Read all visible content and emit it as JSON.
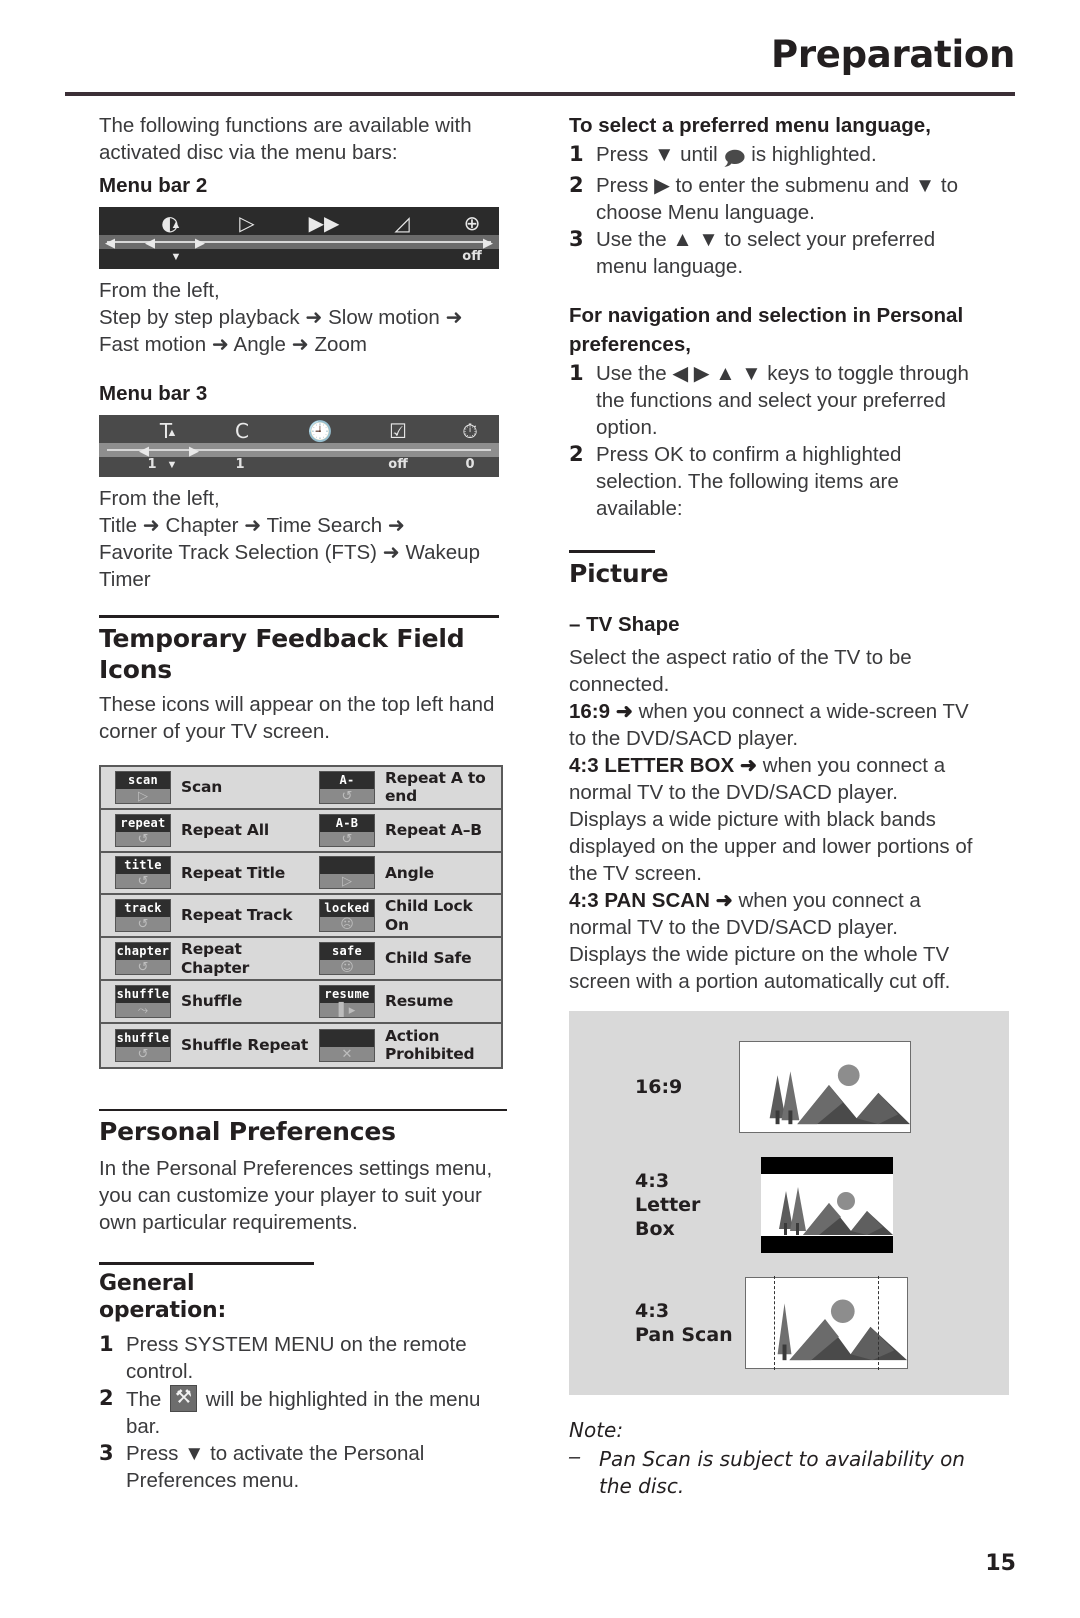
{
  "header": {
    "title": "Preparation"
  },
  "page": {
    "number": "15"
  },
  "left": {
    "intro": "The following functions are available with activated disc via the menu bars:",
    "menu_bar_2_heading": "Menu bar 2",
    "menu_bar_2": {
      "items": [
        {
          "icon": "step-by-step-icon",
          "glyph": "◐",
          "sub": ""
        },
        {
          "icon": "slow-motion-icon",
          "glyph": "▷",
          "sub": ""
        },
        {
          "icon": "fast-motion-icon",
          "glyph": "▶▶",
          "sub": ""
        },
        {
          "icon": "angle-icon",
          "glyph": "◿",
          "sub": ""
        },
        {
          "icon": "zoom-icon",
          "glyph": "⊕",
          "sub": "off"
        }
      ]
    },
    "menu_bar_2_caption_lead": "From the left,",
    "menu_bar_2_caption_line1": "Step by step playback ➜ Slow motion ➜",
    "menu_bar_2_caption_line2": "Fast motion ➜ Angle ➜ Zoom",
    "menu_bar_3_heading": "Menu bar 3",
    "menu_bar_3": {
      "items": [
        {
          "icon": "title-icon",
          "glyph": "T",
          "sub": "1"
        },
        {
          "icon": "chapter-icon",
          "glyph": "C",
          "sub": "1"
        },
        {
          "icon": "time-search-icon",
          "glyph": "🕘",
          "sub": ""
        },
        {
          "icon": "fts-icon",
          "glyph": "☑",
          "sub": "off"
        },
        {
          "icon": "wakeup-timer-icon",
          "glyph": "⏱",
          "sub": "0"
        }
      ]
    },
    "menu_bar_3_caption_lead": "From the left,",
    "menu_bar_3_caption_line1": "Title ➜ Chapter ➜ Time Search ➜",
    "menu_bar_3_caption_line2": "Favorite Track Selection (FTS) ➜ Wakeup Timer",
    "feedback_heading": "Temporary Feedback Field Icons",
    "feedback_intro": "These icons will appear on the top left hand corner of your TV screen.",
    "icon_table": [
      {
        "left": {
          "chip": "scan",
          "symbol": "▷",
          "label": "Scan"
        },
        "right": {
          "chip": "A-",
          "symbol": "↺",
          "label": "Repeat A to end"
        }
      },
      {
        "left": {
          "chip": "repeat",
          "symbol": "↺",
          "label": "Repeat All"
        },
        "right": {
          "chip": "A-B",
          "symbol": "↺",
          "label": "Repeat A–B"
        }
      },
      {
        "left": {
          "chip": "title",
          "symbol": "↺",
          "label": "Repeat Title"
        },
        "right": {
          "chip": "",
          "symbol": "▷",
          "label": "Angle"
        }
      },
      {
        "left": {
          "chip": "track",
          "symbol": "↺",
          "label": "Repeat Track"
        },
        "right": {
          "chip": "locked",
          "symbol": "☹",
          "label": "Child Lock On"
        }
      },
      {
        "left": {
          "chip": "chapter",
          "symbol": "↺",
          "label": "Repeat Chapter"
        },
        "right": {
          "chip": "safe",
          "symbol": "☺",
          "label": "Child Safe"
        }
      },
      {
        "left": {
          "chip": "shuffle",
          "symbol": "⤳",
          "label": "Shuffle"
        },
        "right": {
          "chip": "resume",
          "symbol": "▌▸",
          "label": "Resume"
        }
      },
      {
        "left": {
          "chip": "shuffle",
          "symbol": "↺",
          "label": "Shuffle Repeat"
        },
        "right": {
          "chip": "",
          "symbol": "✕",
          "label": "Action Prohibited"
        }
      }
    ],
    "personal_pref_heading": "Personal Preferences",
    "personal_pref_body": "In the Personal Preferences settings menu, you can customize your player to suit your own particular requirements.",
    "general_operation_heading": "General operation:",
    "general_operation_steps": [
      {
        "num": "1",
        "text": "Press SYSTEM MENU on the remote control."
      },
      {
        "num": "2",
        "text_before": "The ",
        "text_after": " will be highlighted in the menu bar."
      },
      {
        "num": "3",
        "text": "Press ▼ to activate the Personal Preferences menu."
      }
    ]
  },
  "right": {
    "menu_language_heading": "To select a preferred menu language,",
    "menu_language_steps": [
      {
        "num": "1",
        "text_before": "Press ▼ until ",
        "text_after": " is highlighted."
      },
      {
        "num": "2",
        "text": "Press ▶ to enter the submenu and ▼ to choose Menu language."
      },
      {
        "num": "3",
        "text": "Use the ▲ ▼ to select your preferred menu language."
      }
    ],
    "navigation_heading_line1": "For navigation and selection in Personal",
    "navigation_heading_line2": "preferences,",
    "navigation_steps": [
      {
        "num": "1",
        "text": "Use the ◀ ▶ ▲ ▼ keys to toggle through the functions and select your preferred option."
      },
      {
        "num": "2",
        "text": "Press OK to confirm a highlighted selection. The following items are available:"
      }
    ],
    "picture_heading": "Picture",
    "tv_shape_heading": "–  TV Shape",
    "tv_shape_intro": "Select the aspect ratio of the TV to be connected.",
    "tv_shape_16_9_bold": "16:9 ➜",
    "tv_shape_16_9_rest": " when you connect a wide-screen TV to the DVD/SACD player.",
    "tv_shape_lb_bold": "4:3 LETTER BOX ➜",
    "tv_shape_lb_rest": " when you connect a normal TV to the DVD/SACD player. Displays a wide picture with black bands displayed on the upper and lower portions of the TV screen.",
    "tv_shape_ps_bold": "4:3 PAN SCAN ➜",
    "tv_shape_ps_rest": " when you connect a normal TV to the DVD/SACD player. Displays the wide picture on the whole TV screen with a portion automatically cut off.",
    "tv_panel": [
      {
        "label_line1": "16:9",
        "label_line2": "",
        "mode": "wide"
      },
      {
        "label_line1": "4:3",
        "label_line2": "Letter Box",
        "mode": "letterbox"
      },
      {
        "label_line1": "4:3",
        "label_line2": "Pan Scan",
        "mode": "panscan"
      }
    ],
    "note_title": "Note:",
    "note_items": [
      {
        "dash": "–",
        "text": "Pan Scan is subject to availability on the disc."
      }
    ]
  },
  "colors": {
    "ink": "#231f20",
    "body_text": "#3a3a3c",
    "rule": "#3b2f36",
    "panel_bg": "#d9d9d9",
    "menubar_bg": "#2b2b2b",
    "icon_chip_dark": "#2e2e2e",
    "icon_chip_light": "#8a8a8a"
  }
}
